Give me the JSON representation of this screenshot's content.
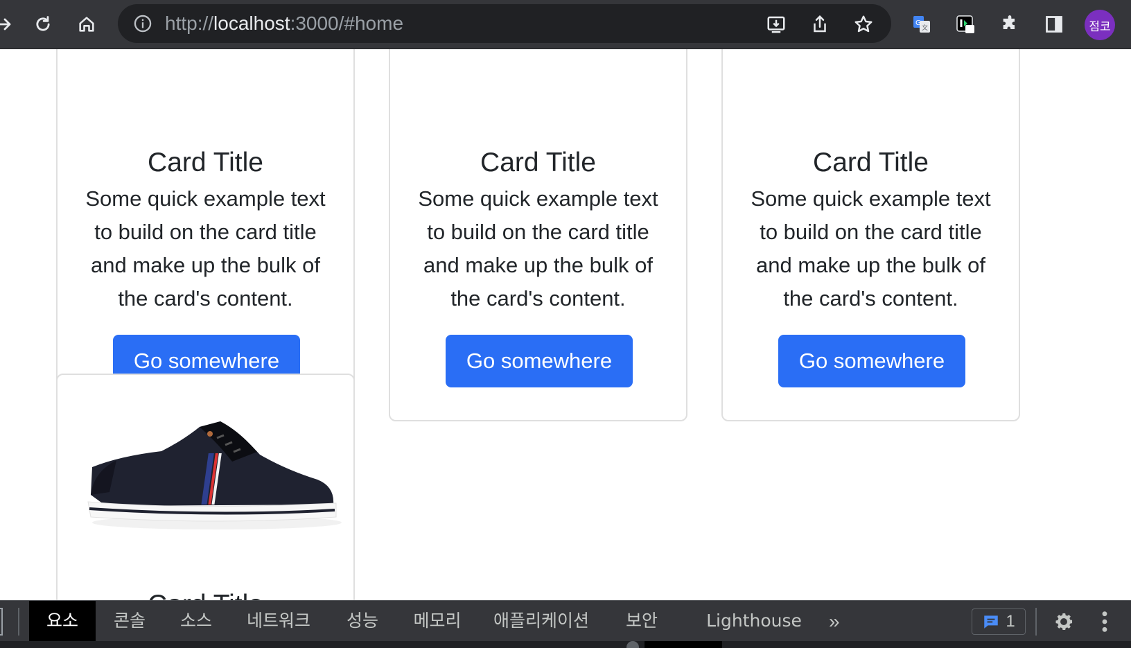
{
  "browser": {
    "url_scheme": "http://",
    "url_host": "localhost",
    "url_rest": ":3000/#home",
    "profile_initials": "점코",
    "icons": [
      "forward-icon",
      "reload-icon",
      "home-icon",
      "info-icon",
      "install-icon",
      "share-icon",
      "star-icon",
      "translate-icon",
      "extension-icon",
      "puzzle-icon",
      "side-panel-icon"
    ]
  },
  "cards": [
    {
      "title": "Card Title",
      "text": "Some quick example text to build on the card title and make up the bulk of the card's content.",
      "button": "Go somewhere"
    },
    {
      "title": "Card Title",
      "text": "Some quick example text to build on the card title and make up the bulk of the card's content.",
      "button": "Go somewhere"
    },
    {
      "title": "Card Title",
      "text": "Some quick example text to build on the card title and make up the bulk of the card's content.",
      "button": "Go somewhere"
    },
    {
      "title": "Card Title",
      "image": "sneaker-image"
    }
  ],
  "devtools": {
    "tabs": [
      "요소",
      "콘솔",
      "소스",
      "네트워크",
      "성능",
      "메모리",
      "애플리케이션",
      "보안",
      "Lighthouse"
    ],
    "active_tab": "요소",
    "more": "»",
    "issues_count": "1"
  },
  "colors": {
    "button_bg": "#2a6ef5",
    "toolbar_bg": "#35363a",
    "omnibox_bg": "#202124",
    "avatar_bg": "#7b2fbf"
  }
}
